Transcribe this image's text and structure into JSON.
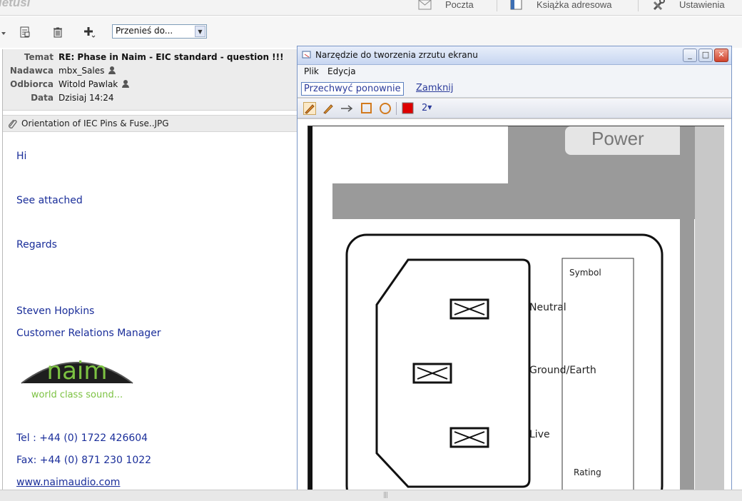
{
  "app": {
    "logo_fragment": "ietusi",
    "nav": [
      {
        "label": "Poczta",
        "icon": "mail-icon"
      },
      {
        "label": "Książka adresowa",
        "icon": "address-book-icon"
      },
      {
        "label": "Ustawienia",
        "icon": "settings-icon"
      }
    ]
  },
  "toolbar": {
    "move_to": "Przenieś do...",
    "icons": [
      "dropdown-arrow-icon",
      "mark-read-icon",
      "delete-icon",
      "add-icon"
    ]
  },
  "message": {
    "headers": [
      {
        "label": "Temat",
        "value": "RE: Phase in Naim - EIC standard - question !!!",
        "bold": true
      },
      {
        "label": "Nadawca",
        "value": "mbx_Sales",
        "person": true
      },
      {
        "label": "Odbiorca",
        "value": "Witold Pawlak",
        "person": true
      },
      {
        "label": "Data",
        "value": "Dzisiaj 14:24"
      }
    ],
    "attachment": "Orientation of IEC Pins & Fuse..JPG",
    "body": {
      "greeting": "Hi",
      "line1": "See attached",
      "regards": "Regards",
      "name": "Steven Hopkins",
      "role": "Customer Relations Manager",
      "tel": "Tel : +44 (0) 1722 426604",
      "fax": "Fax: +44 (0) 871 230 1022",
      "web": "www.naimaudio.com"
    },
    "logo": {
      "brand": "naim",
      "tagline": "world class sound..."
    }
  },
  "snip": {
    "title": "Narzędzie do tworzenia zrzutu ekranu",
    "menu": [
      {
        "label": "Plik"
      },
      {
        "label": "Edycja"
      }
    ],
    "recapture": "Przechwyć ponownie",
    "close": "Zamknij",
    "pen_size": "2",
    "tools": [
      "pen-icon",
      "highlighter-icon",
      "arrow-icon",
      "rectangle-icon",
      "ellipse-icon",
      "color-swatch-icon"
    ],
    "pen_color": "#dd0000"
  },
  "capture": {
    "power": "Power",
    "symbol": "Symbol",
    "neutral": "Neutral",
    "ground": "Ground/Earth",
    "live": "Live",
    "rating": "Rating"
  }
}
